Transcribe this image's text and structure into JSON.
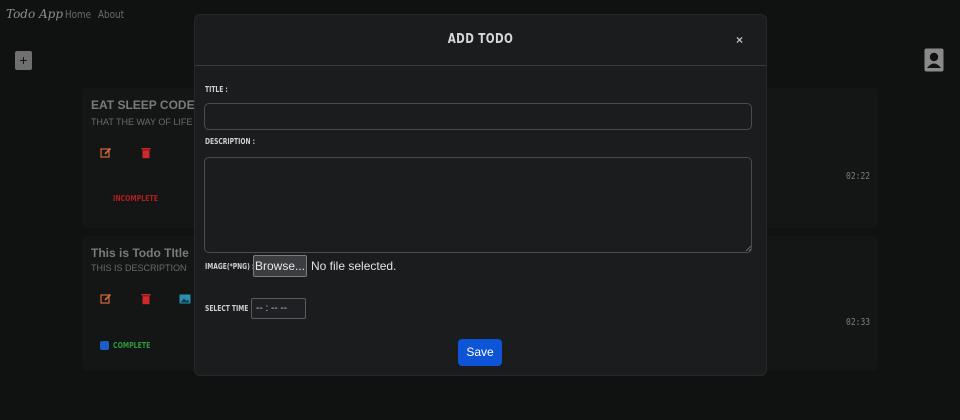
{
  "nav": {
    "brand": "Todo App",
    "links": [
      "Home",
      "About"
    ]
  },
  "toolbar": {
    "add_label": "+"
  },
  "todos": [
    {
      "title": "EAT SLEEP CODE",
      "description": "THAT THE WAY OF LIFE",
      "status": "INCOMPLETE",
      "time": "02:22",
      "status_color": "#b01e1e"
    },
    {
      "title": "This is Todo TItle",
      "description": "THIS IS DESCRIPTION",
      "status": "COMPLETE",
      "time": "02:33",
      "status_color": "#2f9a3d"
    }
  ],
  "modal": {
    "title": "ADD TODO",
    "close": "×",
    "title_label": "TITLE :",
    "title_value": "",
    "description_label": "DESCRIPTION :",
    "description_value": "",
    "image_label": "IMAGE(*PNG) :",
    "browse_label": "Browse...",
    "no_file": "No file selected.",
    "time_label": "SELECT TIME :",
    "time_value": "-- : --   --",
    "save_label": "Save"
  },
  "colors": {
    "accent": "#0d55d6",
    "edit_icon": "#d06a3a",
    "delete_icon": "#d02929",
    "image_icon": "#2a8fb0"
  }
}
